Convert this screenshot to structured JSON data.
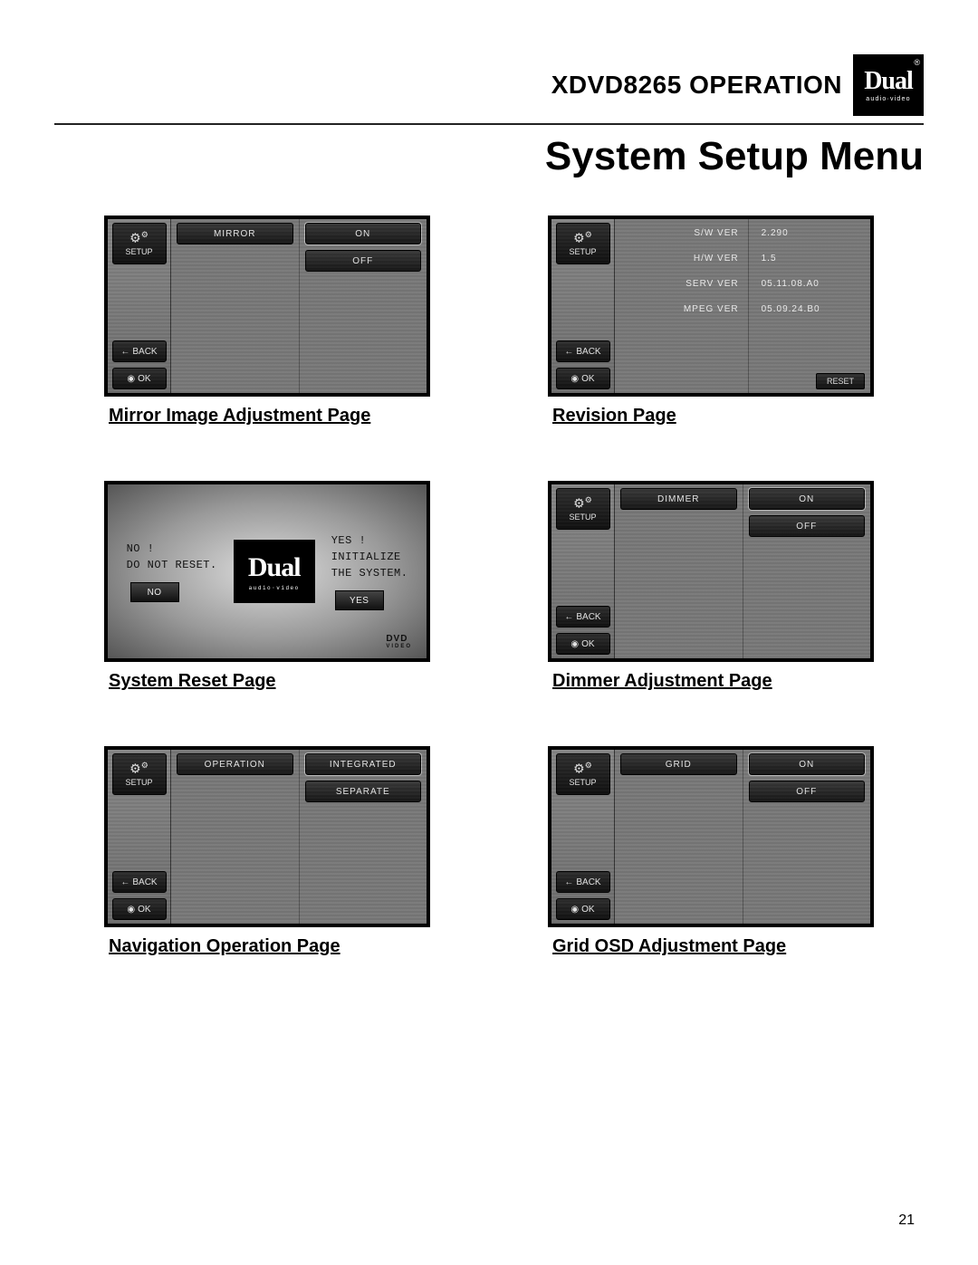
{
  "header": {
    "model": "XDVD8265",
    "operation": "OPERATION"
  },
  "logo": {
    "brand": "Dual",
    "sub": "audio·video",
    "reg": "®"
  },
  "page_title": "System Setup Menu",
  "sidebar": {
    "setup": "SETUP",
    "back": "BACK",
    "ok": "OK"
  },
  "panels": {
    "mirror": {
      "caption": "Mirror Image Adjustment Page",
      "label": "MIRROR",
      "options": [
        "ON",
        "OFF"
      ]
    },
    "revision": {
      "caption": "Revision Page",
      "rows": [
        {
          "k": "S/W VER",
          "v": "2.290"
        },
        {
          "k": "H/W VER",
          "v": "1.5"
        },
        {
          "k": "SERV VER",
          "v": "05.11.08.A0"
        },
        {
          "k": "MPEG VER",
          "v": "05.09.24.B0"
        }
      ],
      "reset": "RESET"
    },
    "reset": {
      "caption": "System Reset Page",
      "left_lines": [
        "NO !",
        "DO NOT RESET."
      ],
      "right_lines": [
        "YES !",
        "INITIALIZE",
        "THE SYSTEM."
      ],
      "no": "NO",
      "yes": "YES",
      "dvd": "DVD",
      "dvd_sub": "VIDEO"
    },
    "dimmer": {
      "caption": "Dimmer Adjustment Page",
      "label": "DIMMER",
      "options": [
        "ON",
        "OFF"
      ]
    },
    "navigation": {
      "caption": "Navigation Operation Page",
      "label": "OPERATION",
      "options": [
        "INTEGRATED",
        "SEPARATE"
      ]
    },
    "grid": {
      "caption": "Grid OSD Adjustment Page",
      "label": "GRID",
      "options": [
        "ON",
        "OFF"
      ]
    }
  },
  "page_number": "21"
}
